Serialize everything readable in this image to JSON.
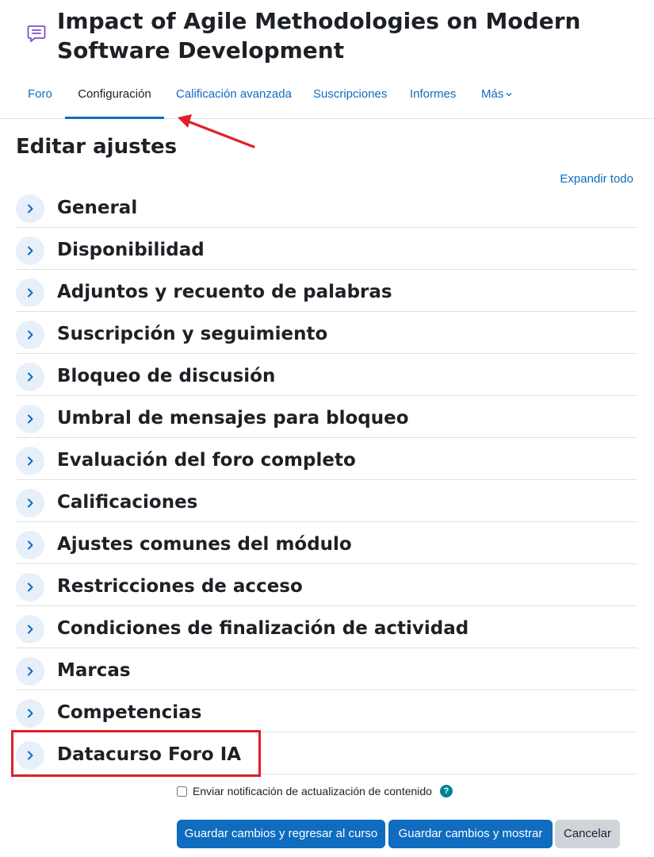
{
  "page": {
    "title": "Impact of Agile Methodologies on Modern Software Development",
    "icon": "forum-icon"
  },
  "tabs": [
    {
      "label": "Foro",
      "active": false
    },
    {
      "label": "Configuración",
      "active": true
    },
    {
      "label": "Calificación avanzada",
      "active": false
    },
    {
      "label": "Suscripciones",
      "active": false
    },
    {
      "label": "Informes",
      "active": false
    },
    {
      "label": "Más",
      "active": false
    }
  ],
  "form": {
    "heading": "Editar ajustes",
    "expand_all": "Expandir todo",
    "sections": [
      {
        "label": "General"
      },
      {
        "label": "Disponibilidad"
      },
      {
        "label": "Adjuntos y recuento de palabras"
      },
      {
        "label": "Suscripción y seguimiento"
      },
      {
        "label": "Bloqueo de discusión"
      },
      {
        "label": "Umbral de mensajes para bloqueo"
      },
      {
        "label": "Evaluación del foro completo"
      },
      {
        "label": "Calificaciones"
      },
      {
        "label": "Ajustes comunes del módulo"
      },
      {
        "label": "Restricciones de acceso"
      },
      {
        "label": "Condiciones de finalización de actividad"
      },
      {
        "label": "Marcas"
      },
      {
        "label": "Competencias"
      },
      {
        "label": "Datacurso Foro IA"
      }
    ],
    "notify_label": "Enviar notificación de actualización de contenido",
    "help_glyph": "?",
    "buttons": {
      "save_return": "Guardar cambios y regresar al curso",
      "save_display": "Guardar cambios y mostrar",
      "cancel": "Cancelar"
    }
  },
  "colors": {
    "link": "#0f6cbf",
    "annotation": "#e0202a",
    "chevron_bg": "#e7effa",
    "help": "#008196"
  }
}
